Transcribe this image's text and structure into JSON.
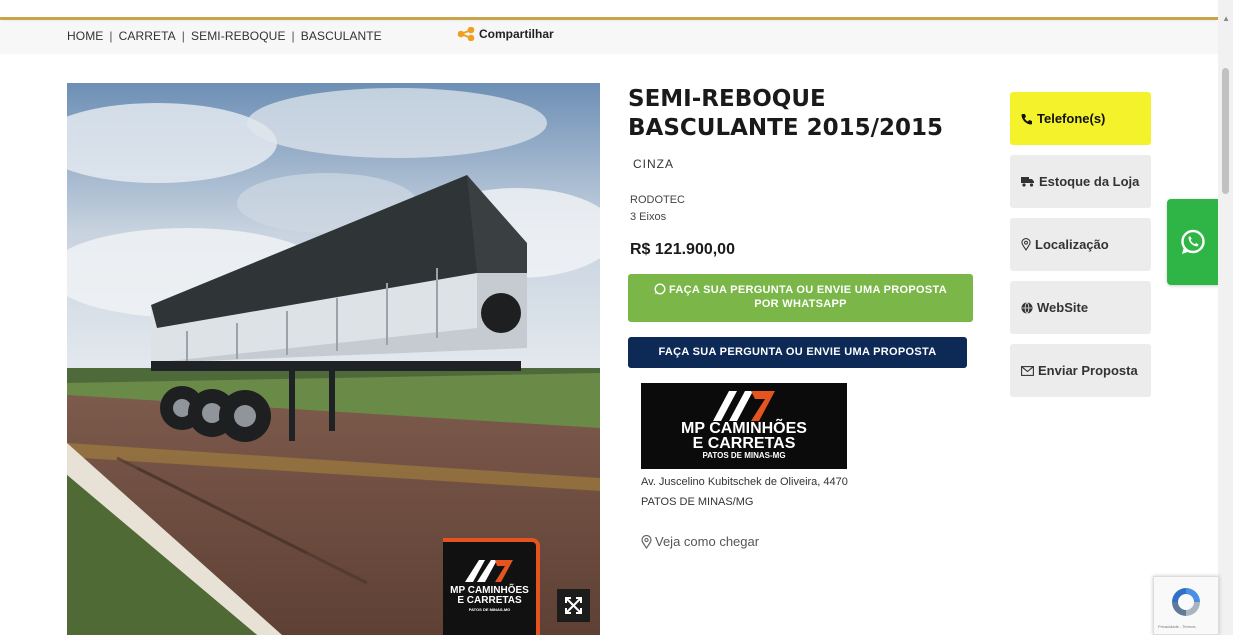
{
  "breadcrumb": {
    "items": [
      "HOME",
      "CARRETA",
      "SEMI-REBOQUE",
      "BASCULANTE"
    ],
    "separator": "|"
  },
  "share": {
    "label": "Compartilhar",
    "icon": "share-icon",
    "color": "#f0a020"
  },
  "listing": {
    "title": "SEMI-REBOQUE BASCULANTE 2015/2015",
    "color": "CINZA",
    "brand": "RODOTEC",
    "axles": "3 Eixos",
    "price": "R$ 121.900,00"
  },
  "actions": {
    "whatsapp_line1": "FAÇA SUA PERGUNTA OU ENVIE UMA PROPOSTA",
    "whatsapp_line2": "POR WHATSAPP",
    "proposal": "FAÇA SUA PERGUNTA OU ENVIE UMA PROPOSTA"
  },
  "dealer": {
    "logo_line1": "MP CAMINHÕES",
    "logo_line2": "E CARRETAS",
    "logo_line3": "PATOS DE MINAS-MG",
    "address": "Av. Juscelino Kubitschek de Oliveira, 4470",
    "city": "PATOS DE MINAS/MG",
    "directions": "Veja como chegar"
  },
  "side_buttons": {
    "telefone": "Telefone(s)",
    "estoque": "Estoque da Loja",
    "localizacao": "Localização",
    "website": "WebSite",
    "enviar": "Enviar Proposta"
  },
  "watermark": {
    "line1": "MP CAMINHÕES",
    "line2": "E CARRETAS",
    "line3": "PATOS DE MINAS-MG"
  },
  "recaptcha": {
    "label": "Privacidade - Termos"
  },
  "colors": {
    "accent": "#c8a44a",
    "whatsapp_green": "#7ab648",
    "navy": "#0d2a57",
    "telefone_yellow": "#f4f22a",
    "float_green": "#2fb545"
  }
}
